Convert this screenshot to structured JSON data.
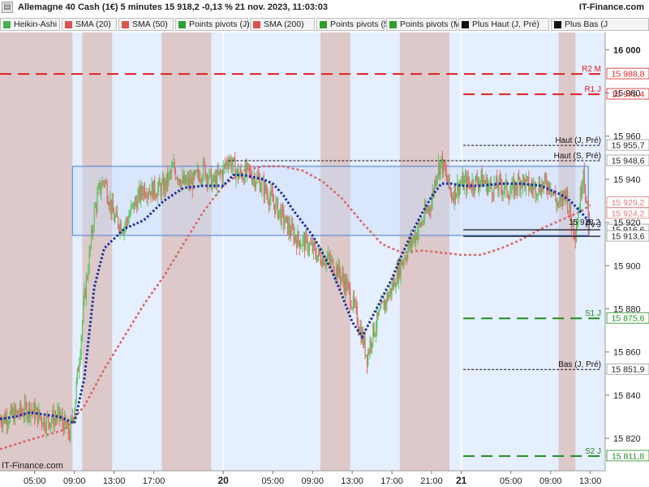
{
  "header": {
    "title": "Allemagne 40 Cash (1€) 5 minutes 15 918,2 -0,13 % 21 nov. 2023, 11:03:03",
    "brand": "IT-Finance.com",
    "collapse_icon": "collapse-icon"
  },
  "legend": {
    "items": [
      {
        "label": "Heikin-Ashi",
        "color": "#4caf50"
      },
      {
        "label": "SMA (20)",
        "color": "#d9534f"
      },
      {
        "label": "SMA (50)",
        "color": "#d9534f"
      },
      {
        "label": "Points pivots (J)",
        "color": "#2ca02c"
      },
      {
        "label": "SMA (200)",
        "color": "#d9534f"
      },
      {
        "label": "Points pivots (S)",
        "color": "#2ca02c"
      },
      {
        "label": "Points pivots (M)",
        "color": "#2ca02c"
      },
      {
        "label": "Plus Haut (J, Pré)",
        "color": "#111111"
      },
      {
        "label": "Plus Bas (J",
        "color": "#111111"
      }
    ]
  },
  "footer": {
    "brand": "IT-Finance.com"
  },
  "colors": {
    "up": "#5cc65c",
    "down": "#e06a6a",
    "sma20": "#1a2fa0",
    "sma200": "#d96464",
    "resistance": "#e02020",
    "support": "#1f8a1f",
    "session_shade": "#dcc4c4",
    "off_session": "#e6efff",
    "box": "#c9dbf6"
  },
  "chart_data": {
    "type": "line",
    "title": "Allemagne 40 Cash (1€) 5 minutes 15 918,2 -0,13 % 21 nov. 2023, 11:03:03",
    "xlabel": "",
    "ylabel": "",
    "ylim": [
      15805,
      16008
    ],
    "y_ticks": [
      "15 820",
      "15 840",
      "15 860",
      "15 880",
      "15 900",
      "15 920",
      "15 940",
      "15 960",
      "15 980",
      "16 000"
    ],
    "y_tick_values": [
      15820,
      15840,
      15860,
      15880,
      15900,
      15920,
      15940,
      15960,
      15980,
      16000
    ],
    "x_ticks": [
      "05:00",
      "09:00",
      "13:00",
      "17:00",
      "20",
      "05:00",
      "09:00",
      "13:00",
      "17:00",
      "21:00",
      "21",
      "05:00",
      "09:00",
      "13:00"
    ],
    "x_tick_hours": [
      5,
      9,
      13,
      17,
      24,
      29,
      33,
      37,
      41,
      45,
      48,
      53,
      57,
      61
    ],
    "x_tick_bold": [
      false,
      false,
      false,
      false,
      true,
      false,
      false,
      false,
      false,
      false,
      true,
      false,
      false,
      false
    ],
    "x_range_hours": [
      1.5,
      62.5
    ],
    "sessions_hours": [
      [
        1.5,
        8.8
      ],
      [
        9.8,
        12.8
      ],
      [
        17.8,
        22.8
      ],
      [
        33.8,
        36.8
      ],
      [
        41.8,
        46.8
      ],
      [
        57.8,
        59.5
      ]
    ],
    "off_session_hours": [
      [
        59.5,
        62.5
      ]
    ],
    "box": {
      "start_hour": 8.8,
      "end_hour": 60.8,
      "high": 15946,
      "low": 15914
    },
    "levels": [
      {
        "name": "R2 M",
        "value": 15988.8,
        "label": "15 988,8",
        "style": "dashed",
        "color": "#e02020",
        "start_hour": 1.5
      },
      {
        "name": "R1 J",
        "value": 15979.4,
        "label": "15 979,4",
        "style": "dashed",
        "color": "#e02020",
        "start_hour": 48.2
      },
      {
        "name": "Haut (J, Pré)",
        "value": 15955.7,
        "label": "15 955,7",
        "style": "dotted",
        "color": "#111111",
        "start_hour": 48.2
      },
      {
        "name": "Haut (S, Pré)",
        "value": 15948.6,
        "label": "15 948,6",
        "style": "dotted",
        "color": "#111111",
        "start_hour": 24.5
      },
      {
        "name": "",
        "value": 15929.2,
        "label": "15 929,2",
        "style": "none",
        "color": "#e37a7a",
        "start_hour": 62
      },
      {
        "name": "",
        "value": 15924.2,
        "label": "15 924,2",
        "style": "none",
        "color": "#e37a7a",
        "start_hour": 62
      },
      {
        "name": "Pv J",
        "value": 15916.6,
        "label": "15 916,6",
        "style": "solid",
        "color": "#111111",
        "start_hour": 48.2
      },
      {
        "name": "",
        "value": 15913.6,
        "label": "15 913,6",
        "style": "solid",
        "color": "#111111",
        "start_hour": 48.2
      },
      {
        "name": "S1 J",
        "value": 15875.6,
        "label": "15 875,6",
        "style": "dashed",
        "color": "#1f8a1f",
        "start_hour": 48.2
      },
      {
        "name": "Bas (J, Pré)",
        "value": 15851.9,
        "label": "15 851,9",
        "style": "dotted",
        "color": "#111111",
        "start_hour": 48.2
      },
      {
        "name": "S2 J",
        "value": 15811.8,
        "label": "15 811,8",
        "style": "dashed",
        "color": "#1f8a1f",
        "start_hour": 48.2
      }
    ],
    "last_price": {
      "value": 15918.2,
      "label": "15 918,2"
    },
    "price_hours": [
      1.5,
      3.0,
      4.5,
      6.0,
      7.5,
      8.5,
      9.0,
      9.5,
      10.0,
      10.5,
      11.0,
      11.5,
      12.0,
      13.0,
      14.0,
      15.0,
      16.0,
      17.0,
      18.0,
      19.0,
      20.0,
      21.0,
      22.0,
      23.0,
      24.0,
      24.5,
      25.5,
      26.5,
      27.5,
      28.5,
      29.5,
      30.5,
      31.5,
      32.5,
      33.5,
      34.5,
      35.5,
      36.5,
      37.5,
      38.5,
      39.0,
      40.0,
      41.0,
      42.0,
      43.0,
      44.0,
      45.0,
      45.5,
      46.0,
      47.0,
      48.0,
      49.0,
      50.0,
      51.0,
      52.0,
      53.0,
      54.0,
      55.0,
      56.0,
      57.0,
      57.5,
      58.0,
      58.5,
      59.0,
      59.5,
      60.0,
      60.3,
      60.6,
      61.0
    ],
    "price_values": [
      15829,
      15831,
      15834,
      15828,
      15830,
      15822,
      15835,
      15858,
      15885,
      15904,
      15925,
      15935,
      15940,
      15922,
      15918,
      15928,
      15936,
      15935,
      15936,
      15945,
      15938,
      15939,
      15945,
      15938,
      15944,
      15950,
      15942,
      15943,
      15940,
      15933,
      15926,
      15918,
      15912,
      15910,
      15905,
      15903,
      15898,
      15890,
      15876,
      15858,
      15868,
      15880,
      15890,
      15902,
      15911,
      15920,
      15930,
      15944,
      15948,
      15933,
      15938,
      15938,
      15940,
      15936,
      15937,
      15934,
      15940,
      15936,
      15937,
      15938,
      15930,
      15928,
      15935,
      15922,
      15916,
      15932,
      15946,
      15928,
      15918
    ],
    "series": [
      {
        "name": "SMA (20)",
        "x": [
          1.5,
          3,
          4.5,
          6,
          7.5,
          9,
          10,
          11,
          12,
          14,
          16,
          18,
          20,
          22,
          24,
          25,
          26,
          27,
          28,
          29,
          30,
          31,
          32,
          33,
          34,
          35,
          36,
          37,
          38,
          39,
          40,
          41,
          42,
          43,
          44,
          45,
          46,
          47,
          48,
          50,
          52,
          54,
          56,
          57,
          58,
          59,
          60,
          61
        ],
        "values": [
          15829,
          15830,
          15832,
          15831,
          15830,
          15827,
          15848,
          15890,
          15908,
          15917,
          15921,
          15930,
          15936,
          15937,
          15937,
          15942,
          15942,
          15941,
          15940,
          15938,
          15933,
          15926,
          15920,
          15914,
          15906,
          15897,
          15886,
          15874,
          15867,
          15876,
          15885,
          15894,
          15905,
          15915,
          15924,
          15932,
          15938,
          15938,
          15937,
          15937,
          15938,
          15938,
          15937,
          15935,
          15933,
          15930,
          15925,
          15920
        ]
      },
      {
        "name": "SMA (200)",
        "x": [
          1.5,
          5,
          8,
          10,
          12,
          14,
          16,
          18,
          20,
          22,
          24,
          26,
          28,
          30,
          32,
          34,
          36,
          38,
          40,
          42,
          44,
          46,
          48,
          50,
          52,
          54,
          56,
          58,
          60,
          61
        ],
        "values": [
          15815,
          15820,
          15824,
          15835,
          15852,
          15867,
          15882,
          15895,
          15910,
          15925,
          15937,
          15944,
          15946,
          15946,
          15944,
          15939,
          15931,
          15920,
          15910,
          15906,
          15907,
          15906,
          15905,
          15905,
          15908,
          15912,
          15917,
          15921,
          15925,
          15928
        ]
      }
    ]
  }
}
